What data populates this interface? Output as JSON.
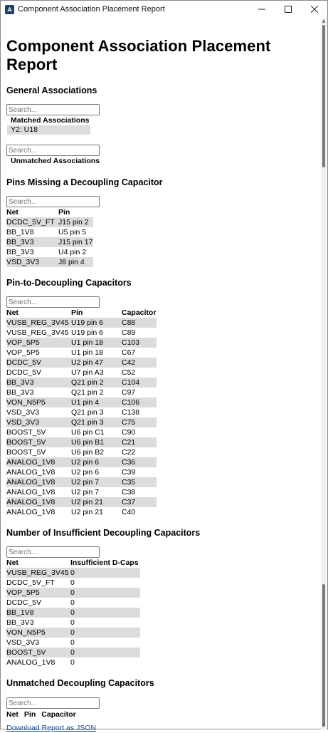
{
  "window": {
    "title": "Component Association Placement Report",
    "buttons": {
      "minimize": "—",
      "maximize": "☐",
      "close": "✕"
    }
  },
  "report": {
    "title": "Component Association Placement Report",
    "search_placeholder": "Search...",
    "general": {
      "heading": "General Associations",
      "matched_label": "Matched Associations",
      "matched": [
        "Y2: U18"
      ],
      "unmatched_label": "Unmatched Associations"
    },
    "missing": {
      "heading": "Pins Missing a Decoupling Capacitor",
      "columns": [
        "Net",
        "Pin"
      ],
      "rows": [
        [
          "DCDC_5V_FT",
          "J15 pin 2"
        ],
        [
          "BB_1V8",
          "U5 pin 5"
        ],
        [
          "BB_3V3",
          "J15 pin 17"
        ],
        [
          "BB_3V3",
          "U4 pin 2"
        ],
        [
          "VSD_3V3",
          "J8 pin 4"
        ]
      ]
    },
    "pin_to_cap": {
      "heading": "Pin-to-Decoupling Capacitors",
      "columns": [
        "Net",
        "Pin",
        "Capacitor"
      ],
      "rows": [
        [
          "VUSB_REG_3V45",
          "U19 pin 6",
          "C88"
        ],
        [
          "VUSB_REG_3V45",
          "U19 pin 6",
          "C89"
        ],
        [
          "VOP_5P5",
          "U1 pin 18",
          "C103"
        ],
        [
          "VOP_5P5",
          "U1 pin 18",
          "C67"
        ],
        [
          "DCDC_5V",
          "U2 pin 47",
          "C42"
        ],
        [
          "DCDC_5V",
          "U7 pin A3",
          "C52"
        ],
        [
          "BB_3V3",
          "Q21 pin 2",
          "C104"
        ],
        [
          "BB_3V3",
          "Q21 pin 2",
          "C97"
        ],
        [
          "VON_N5P5",
          "U1 pin 4",
          "C106"
        ],
        [
          "VSD_3V3",
          "Q21 pin 3",
          "C138"
        ],
        [
          "VSD_3V3",
          "Q21 pin 3",
          "C75"
        ],
        [
          "BOOST_5V",
          "U6 pin C1",
          "C90"
        ],
        [
          "BOOST_5V",
          "U6 pin B1",
          "C21"
        ],
        [
          "BOOST_5V",
          "U6 pin B2",
          "C22"
        ],
        [
          "ANALOG_1V8",
          "U2 pin 6",
          "C36"
        ],
        [
          "ANALOG_1V8",
          "U2 pin 6",
          "C39"
        ],
        [
          "ANALOG_1V8",
          "U2 pin 7",
          "C35"
        ],
        [
          "ANALOG_1V8",
          "U2 pin 7",
          "C38"
        ],
        [
          "ANALOG_1V8",
          "U2 pin 21",
          "C37"
        ],
        [
          "ANALOG_1V8",
          "U2 pin 21",
          "C40"
        ]
      ]
    },
    "insufficient": {
      "heading": "Number of Insufficient Decoupling Capacitors",
      "columns": [
        "Net",
        "Insufficient D-Caps"
      ],
      "rows": [
        [
          "VUSB_REG_3V45",
          "0"
        ],
        [
          "DCDC_5V_FT",
          "0"
        ],
        [
          "VOP_5P5",
          "0"
        ],
        [
          "DCDC_5V",
          "0"
        ],
        [
          "BB_1V8",
          "0"
        ],
        [
          "BB_3V3",
          "0"
        ],
        [
          "VON_N5P5",
          "0"
        ],
        [
          "VSD_3V3",
          "0"
        ],
        [
          "BOOST_5V",
          "0"
        ],
        [
          "ANALOG_1V8",
          "0"
        ]
      ]
    },
    "unmatched_caps": {
      "heading": "Unmatched Decoupling Capacitors",
      "columns": [
        "Net",
        "Pin",
        "Capacitor"
      ]
    },
    "download_link": "Download Report as JSON"
  }
}
